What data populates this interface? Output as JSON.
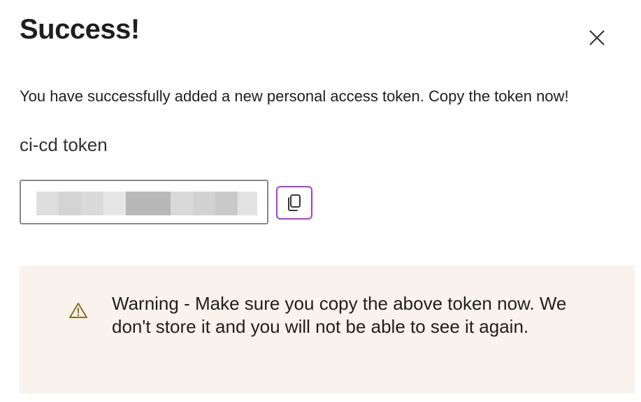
{
  "dialog": {
    "title": "Success!",
    "message": "You have successfully added a new personal access token. Copy the token now!",
    "token_name": "ci-cd token"
  },
  "token_field": {
    "value_masked": true
  },
  "icons": {
    "close": "close-icon",
    "copy": "copy-icon",
    "warning": "warning-icon"
  },
  "warning": {
    "text": "Warning - Make sure you copy the above token now. We don't store it and you will not be able to see it again."
  },
  "colors": {
    "copy_button_border": "#a23fd6",
    "warning_background": "#faf2ec",
    "warning_icon": "#8a6d1e"
  }
}
